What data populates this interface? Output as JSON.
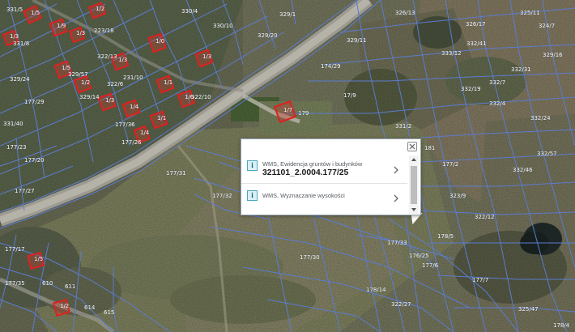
{
  "map": {
    "parcel_labels": [
      {
        "id": "l1",
        "text": "331/5"
      },
      {
        "id": "l2",
        "text": "330/4"
      },
      {
        "id": "l3",
        "text": "329/1"
      },
      {
        "id": "l4",
        "text": "326/13"
      },
      {
        "id": "l5",
        "text": "325/11"
      },
      {
        "id": "l6",
        "text": "331/8"
      },
      {
        "id": "l7",
        "text": "330/10"
      },
      {
        "id": "l8",
        "text": "329/11"
      },
      {
        "id": "l9",
        "text": "326/17"
      },
      {
        "id": "l10",
        "text": "324/7"
      },
      {
        "id": "l11",
        "text": "223/18"
      },
      {
        "id": "l12",
        "text": "322/13"
      },
      {
        "id": "l13",
        "text": "231/10"
      },
      {
        "id": "l14",
        "text": "322/6"
      },
      {
        "id": "l15",
        "text": "322/10"
      },
      {
        "id": "l16",
        "text": "329/20"
      },
      {
        "id": "l17",
        "text": "174/29"
      },
      {
        "id": "l18",
        "text": "17/9"
      },
      {
        "id": "l19",
        "text": "329/57"
      },
      {
        "id": "l20",
        "text": "329/14"
      },
      {
        "id": "l21",
        "text": "329/24"
      },
      {
        "id": "l22",
        "text": "177/29"
      },
      {
        "id": "l23",
        "text": "177/23"
      },
      {
        "id": "l24",
        "text": "177/20"
      },
      {
        "id": "l25",
        "text": "177/26"
      },
      {
        "id": "l26",
        "text": "177/31"
      },
      {
        "id": "l27",
        "text": "177/32"
      },
      {
        "id": "l28",
        "text": "177/30"
      },
      {
        "id": "l29",
        "text": "177/33"
      },
      {
        "id": "l30",
        "text": "176/25"
      },
      {
        "id": "l31",
        "text": "178/5"
      },
      {
        "id": "l32",
        "text": "178/14"
      },
      {
        "id": "l33",
        "text": "322/27"
      },
      {
        "id": "l34",
        "text": "325/47"
      },
      {
        "id": "l35",
        "text": "323/9"
      },
      {
        "id": "l36",
        "text": "322/12"
      },
      {
        "id": "l37",
        "text": "332/4"
      },
      {
        "id": "l38",
        "text": "332/7"
      },
      {
        "id": "l39",
        "text": "332/19"
      },
      {
        "id": "l40",
        "text": "332/24"
      },
      {
        "id": "l41",
        "text": "332/31"
      },
      {
        "id": "l42",
        "text": "332/46"
      },
      {
        "id": "l43",
        "text": "332/57"
      },
      {
        "id": "l44",
        "text": "177/6"
      },
      {
        "id": "l45",
        "text": "177/7"
      },
      {
        "id": "l46",
        "text": "178/4"
      },
      {
        "id": "l47",
        "text": "177/27"
      },
      {
        "id": "l48",
        "text": "177/17"
      },
      {
        "id": "l49",
        "text": "177/35"
      },
      {
        "id": "l50",
        "text": "177/36"
      },
      {
        "id": "l51",
        "text": "610"
      },
      {
        "id": "l52",
        "text": "611"
      },
      {
        "id": "l53",
        "text": "614"
      },
      {
        "id": "l54",
        "text": "615"
      },
      {
        "id": "l55",
        "text": "179"
      },
      {
        "id": "l56",
        "text": "181"
      },
      {
        "id": "l57",
        "text": "177/2"
      },
      {
        "id": "l58",
        "text": "331/2"
      },
      {
        "id": "l59",
        "text": "329/16"
      },
      {
        "id": "l60",
        "text": "333/12"
      },
      {
        "id": "l61",
        "text": "332/41"
      },
      {
        "id": "l62",
        "text": "331/40"
      }
    ],
    "building_labels": [
      {
        "id": "b1",
        "text": "1/5"
      },
      {
        "id": "b2",
        "text": "1/2"
      },
      {
        "id": "b3",
        "text": "1/9"
      },
      {
        "id": "b4",
        "text": "1/3"
      },
      {
        "id": "b5",
        "text": "1/3"
      },
      {
        "id": "b6",
        "text": "1/0"
      },
      {
        "id": "b7",
        "text": "1/3"
      },
      {
        "id": "b8",
        "text": "1/3"
      },
      {
        "id": "b9",
        "text": "1/5"
      },
      {
        "id": "b10",
        "text": "1/2"
      },
      {
        "id": "b11",
        "text": "1/1"
      },
      {
        "id": "b12",
        "text": "1/6"
      },
      {
        "id": "b13",
        "text": "1/3"
      },
      {
        "id": "b14",
        "text": "1/4"
      },
      {
        "id": "b15",
        "text": "1/1"
      },
      {
        "id": "b16",
        "text": "1/4"
      },
      {
        "id": "b17",
        "text": "1/7"
      },
      {
        "id": "b18",
        "text": "1/5"
      },
      {
        "id": "b19",
        "text": "1/2"
      }
    ]
  },
  "popup": {
    "items": [
      {
        "layer": "WMS, Ewidencja gruntów i budynków",
        "value": "321101_2.0004.177/25"
      },
      {
        "layer": "WMS, Wyznaczanie wysokości",
        "value": ""
      }
    ],
    "info_icon_glyph": "i",
    "close_icon": "close-icon",
    "chevron_icon": "chevron-right-icon"
  },
  "colors": {
    "parcel_outline": "#5b7cd0",
    "building_outline": "#e02020",
    "road": "#9c9a92",
    "label_text": "#ffffff"
  }
}
